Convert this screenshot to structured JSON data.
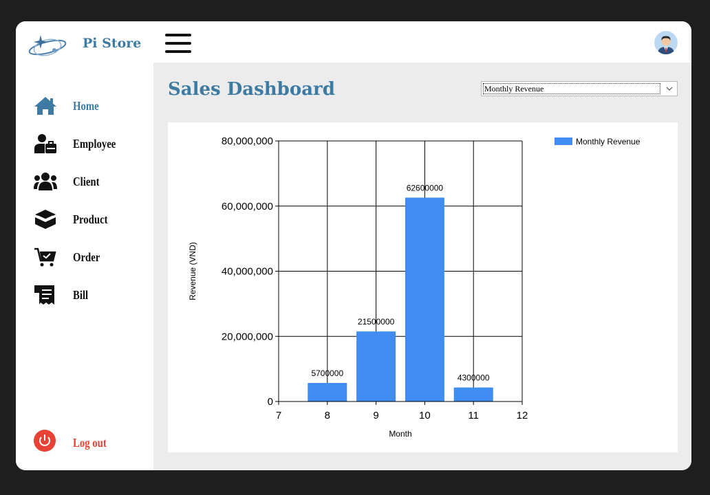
{
  "app": {
    "brand_name": "Pi Store"
  },
  "sidebar": {
    "items": [
      {
        "key": "home",
        "label": "Home",
        "icon": "home-icon",
        "active": true
      },
      {
        "key": "employee",
        "label": "Employee",
        "icon": "employee-badge-icon",
        "active": false
      },
      {
        "key": "client",
        "label": "Client",
        "icon": "users-icon",
        "active": false
      },
      {
        "key": "product",
        "label": "Product",
        "icon": "box-icon",
        "active": false
      },
      {
        "key": "order",
        "label": "Order",
        "icon": "cart-check-icon",
        "active": false
      },
      {
        "key": "bill",
        "label": "Bill",
        "icon": "receipt-icon",
        "active": false
      }
    ],
    "logout_label": "Log out"
  },
  "main": {
    "title": "Sales Dashboard",
    "report_select": {
      "value": "Monthly Revenue"
    }
  },
  "colors": {
    "accent": "#3d7ba3",
    "bar": "#418cf0",
    "logout": "#e74235",
    "content_bg": "#ececec"
  },
  "chart_data": {
    "type": "bar",
    "x": [
      8,
      9,
      10,
      11
    ],
    "series": [
      {
        "name": "Monthly Revenue",
        "values": [
          5700000,
          21500000,
          62600000,
          4300000
        ]
      }
    ],
    "data_labels": [
      "5700000",
      "21500000",
      "62600000",
      "4300000"
    ],
    "xlabel": "Month",
    "ylabel": "Revenue (VND)",
    "xlim": [
      7,
      12
    ],
    "ylim": [
      0,
      80000000
    ],
    "xticks": [
      7,
      8,
      9,
      10,
      11,
      12
    ],
    "xtick_labels": [
      "7",
      "8",
      "9",
      "10",
      "11",
      "12"
    ],
    "yticks": [
      0,
      20000000,
      40000000,
      60000000,
      80000000
    ],
    "ytick_labels": [
      "0",
      "20,000,000",
      "40,000,000",
      "60,000,000",
      "80,000,000"
    ],
    "grid": true,
    "legend_position": "top-right"
  }
}
